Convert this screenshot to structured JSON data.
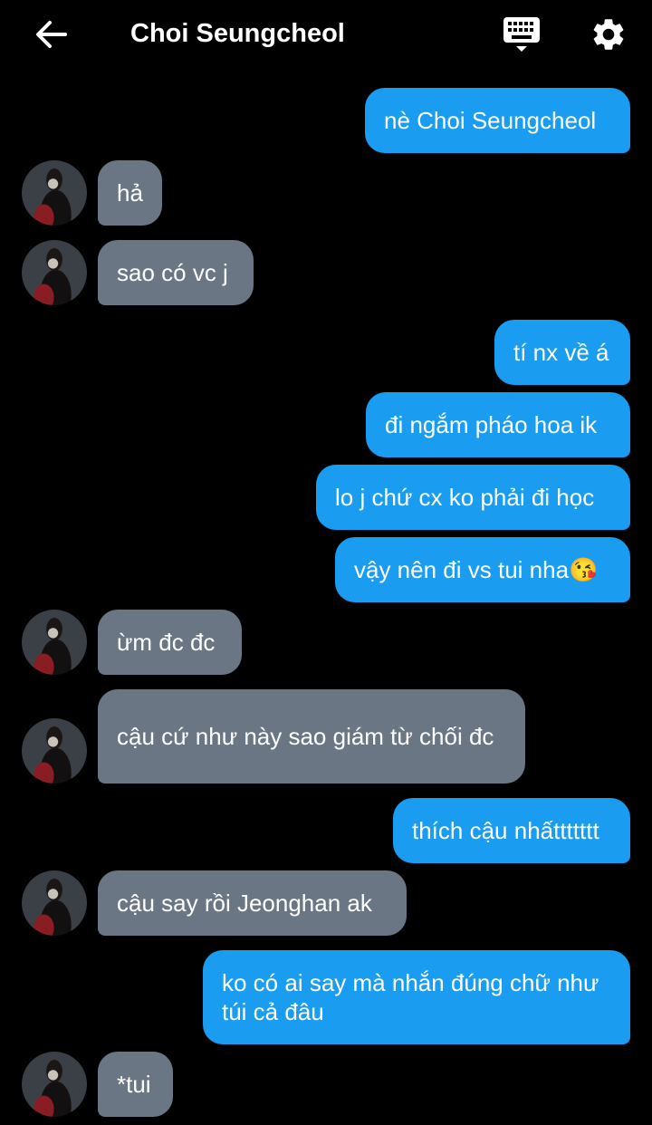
{
  "header": {
    "title": "Choi Seungcheol",
    "back_icon": "arrow-left-icon",
    "keyboard_icon": "keyboard-icon",
    "settings_icon": "gear-icon"
  },
  "colors": {
    "background": "#000000",
    "sent_bubble": "#1a9cf0",
    "received_bubble": "#6a7683",
    "text": "#ffffff"
  },
  "messages": [
    {
      "from": "me",
      "text": "nè Choi Seungcheol"
    },
    {
      "from": "them",
      "text": "hả"
    },
    {
      "from": "them",
      "text": "sao có vc j"
    },
    {
      "from": "me",
      "text": "tí nx về á"
    },
    {
      "from": "me",
      "text": "đi ngắm pháo hoa ik"
    },
    {
      "from": "me",
      "text": "lo j chứ cx ko phải đi học"
    },
    {
      "from": "me",
      "text": "vậy nên đi vs tui nha😘"
    },
    {
      "from": "them",
      "text": "ừm đc đc"
    },
    {
      "from": "them",
      "text": "cậu cứ như này sao giám từ chối đc"
    },
    {
      "from": "me",
      "text": "thích cậu nhấttttttt"
    },
    {
      "from": "them",
      "text": "cậu say rồi Jeonghan ak"
    },
    {
      "from": "me",
      "text": "ko có ai say mà nhắn đúng chữ như túi cả đâu"
    },
    {
      "from": "them",
      "text": "*tui"
    }
  ]
}
